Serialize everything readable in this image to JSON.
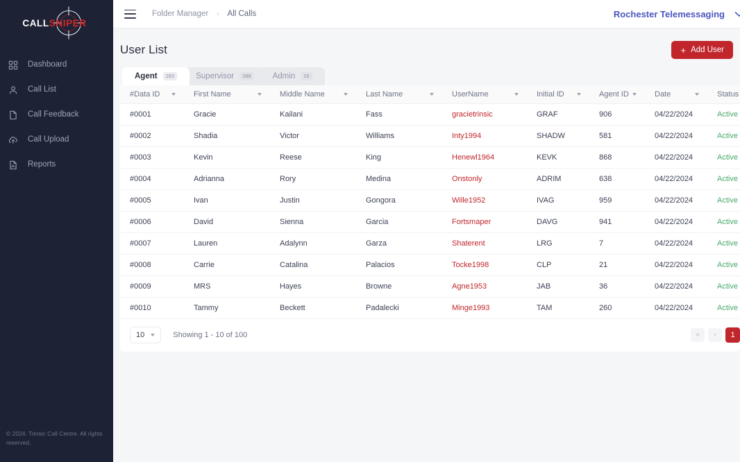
{
  "brand": {
    "logo_primary": "CALL",
    "logo_accent": "SNIPER",
    "accent_color": "#c0262b",
    "sidebar_bg": "#1e2235",
    "tenant_color": "#4c56c0",
    "status_color": "#4aa96c"
  },
  "sidebar": {
    "items": [
      {
        "label": "Dashboard",
        "icon": "grid-icon"
      },
      {
        "label": "Call List",
        "icon": "user-icon"
      },
      {
        "label": "Call Feedback",
        "icon": "document-icon"
      },
      {
        "label": "Call Upload",
        "icon": "cloud-upload-icon"
      },
      {
        "label": "Reports",
        "icon": "report-icon"
      }
    ],
    "footer": "© 2024. Trinsic Call Centre. All rights reserved."
  },
  "topbar": {
    "menu_icon": "hamburger-icon",
    "breadcrumb": [
      {
        "label": "Folder Manager"
      },
      {
        "label": "All Calls"
      }
    ],
    "breadcrumb_separator": "›",
    "tenant": "Rochester Telemessaging"
  },
  "page": {
    "title": "User List",
    "add_user_label": "Add User",
    "add_user_plus": "+"
  },
  "tabs": [
    {
      "label": "Agent",
      "badge": "283",
      "active": true
    },
    {
      "label": "Supervisor",
      "badge": "288",
      "active": false
    },
    {
      "label": "Admin",
      "badge": "15",
      "active": false
    }
  ],
  "table": {
    "columns": [
      {
        "label": "#Data ID",
        "sortable": true
      },
      {
        "label": "First Name",
        "sortable": true
      },
      {
        "label": "Middle Name",
        "sortable": true
      },
      {
        "label": "Last Name",
        "sortable": true
      },
      {
        "label": "UserName",
        "sortable": true
      },
      {
        "label": "Initial ID",
        "sortable": true
      },
      {
        "label": "Agent ID",
        "sortable": true
      },
      {
        "label": "Date",
        "sortable": true
      },
      {
        "label": "Status",
        "sortable": false
      }
    ],
    "rows": [
      {
        "data_id": "#0001",
        "first": "Gracie",
        "middle": "Kailani",
        "last": "Fass",
        "username": "gracietrinsic",
        "initial": "GRAF",
        "agent": "906",
        "date": "04/22/2024",
        "status": "Active"
      },
      {
        "data_id": "#0002",
        "first": "Shadia",
        "middle": "Victor",
        "last": "Williams",
        "username": "Inty1994",
        "initial": "SHADW",
        "agent": "581",
        "date": "04/22/2024",
        "status": "Active"
      },
      {
        "data_id": "#0003",
        "first": "Kevin",
        "middle": "Reese",
        "last": "King",
        "username": "Henewl1964",
        "initial": "KEVK",
        "agent": "868",
        "date": "04/22/2024",
        "status": "Active"
      },
      {
        "data_id": "#0004",
        "first": "Adrianna",
        "middle": "Rory",
        "last": "Medina",
        "username": "Onstonly",
        "initial": "ADRIM",
        "agent": "638",
        "date": "04/22/2024",
        "status": "Active"
      },
      {
        "data_id": "#0005",
        "first": "Ivan",
        "middle": "Justin",
        "last": "Gongora",
        "username": "Wille1952",
        "initial": "IVAG",
        "agent": "959",
        "date": "04/22/2024",
        "status": "Active"
      },
      {
        "data_id": "#0006",
        "first": "David",
        "middle": "Sienna",
        "last": "Garcia",
        "username": "Fortsmaper",
        "initial": "DAVG",
        "agent": "941",
        "date": "04/22/2024",
        "status": "Active"
      },
      {
        "data_id": "#0007",
        "first": "Lauren",
        "middle": "Adalynn",
        "last": "Garza",
        "username": "Shaterent",
        "initial": "LRG",
        "agent": "7",
        "date": "04/22/2024",
        "status": "Active"
      },
      {
        "data_id": "#0008",
        "first": "Carrie",
        "middle": "Catalina",
        "last": "Palacios",
        "username": "Tocke1998",
        "initial": "CLP",
        "agent": "21",
        "date": "04/22/2024",
        "status": "Active"
      },
      {
        "data_id": "#0009",
        "first": "MRS",
        "middle": "Hayes",
        "last": "Browne",
        "username": "Agne1953",
        "initial": "JAB",
        "agent": "36",
        "date": "04/22/2024",
        "status": "Active"
      },
      {
        "data_id": "#0010",
        "first": "Tammy",
        "middle": "Beckett",
        "last": "Padalecki",
        "username": "Minge1993",
        "initial": "TAM",
        "agent": "260",
        "date": "04/22/2024",
        "status": "Active"
      }
    ]
  },
  "pagination": {
    "per_page": "10",
    "showing": "Showing 1 - 10 of 100",
    "first_label": "«",
    "prev_label": "‹",
    "current_page": "1"
  }
}
